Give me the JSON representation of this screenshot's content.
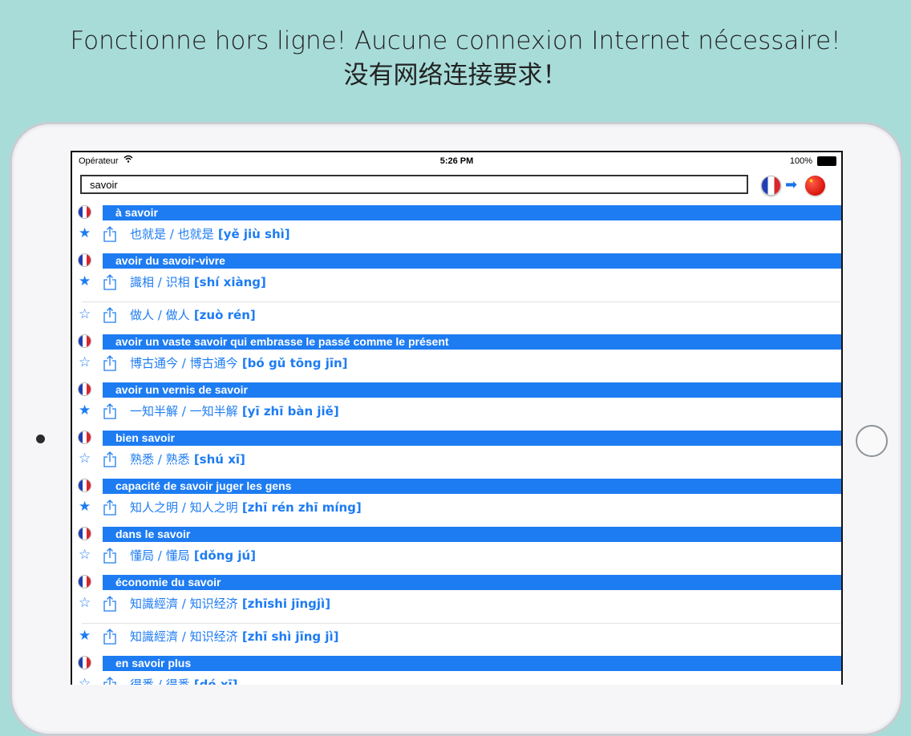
{
  "headline": {
    "line1": "Fonctionne hors ligne! Aucune connexion Internet nécessaire!",
    "line2": "没有网络连接要求！"
  },
  "status_bar": {
    "carrier": "Opérateur",
    "time": "5:26 PM",
    "battery": "100%"
  },
  "search": {
    "value": "savoir",
    "source_flag": "france-flag-icon",
    "direction_icon": "arrow-right-icon",
    "target_flag": "china-flag-icon"
  },
  "colors": {
    "accent": "#1e7cf2",
    "background": "#a8dcd9"
  },
  "entries": [
    {
      "french": "à savoir",
      "translations": [
        {
          "starred": true,
          "trad": "也就是 / 也就是",
          "pinyin": "[yě jiù shì]"
        }
      ]
    },
    {
      "french": "avoir du savoir-vivre",
      "translations": [
        {
          "starred": true,
          "trad": "識相 / 识相",
          "pinyin": "[shí xiàng]"
        },
        {
          "starred": false,
          "trad": "做人 / 做人",
          "pinyin": "[zuò rén]"
        }
      ]
    },
    {
      "french": "avoir un vaste savoir qui embrasse le passé comme le présent",
      "translations": [
        {
          "starred": false,
          "trad": "博古通今 / 博古通今",
          "pinyin": "[bó gǔ tōng jīn]"
        }
      ]
    },
    {
      "french": "avoir un vernis de savoir",
      "translations": [
        {
          "starred": true,
          "trad": "一知半解 / 一知半解",
          "pinyin": "[yī zhī bàn jiě]"
        }
      ]
    },
    {
      "french": "bien savoir",
      "translations": [
        {
          "starred": false,
          "trad": "熟悉 / 熟悉",
          "pinyin": "[shú xī]"
        }
      ]
    },
    {
      "french": "capacité de savoir juger les gens",
      "translations": [
        {
          "starred": true,
          "trad": "知人之明 / 知人之明",
          "pinyin": "[zhī rén zhī míng]"
        }
      ]
    },
    {
      "french": "dans le savoir",
      "translations": [
        {
          "starred": false,
          "trad": "懂局 / 懂局",
          "pinyin": "[dǒng jú]"
        }
      ]
    },
    {
      "french": "économie du savoir",
      "translations": [
        {
          "starred": false,
          "trad": "知識經濟 / 知识经济",
          "pinyin": "[zhīshi jīngjì]"
        },
        {
          "starred": true,
          "trad": "知識經濟 / 知识经济",
          "pinyin": "[zhī shì jīng jì]"
        }
      ]
    },
    {
      "french": "en savoir plus",
      "translations": [
        {
          "starred": false,
          "trad": "得悉 / 得悉",
          "pinyin": "[dé xī]"
        }
      ]
    }
  ]
}
